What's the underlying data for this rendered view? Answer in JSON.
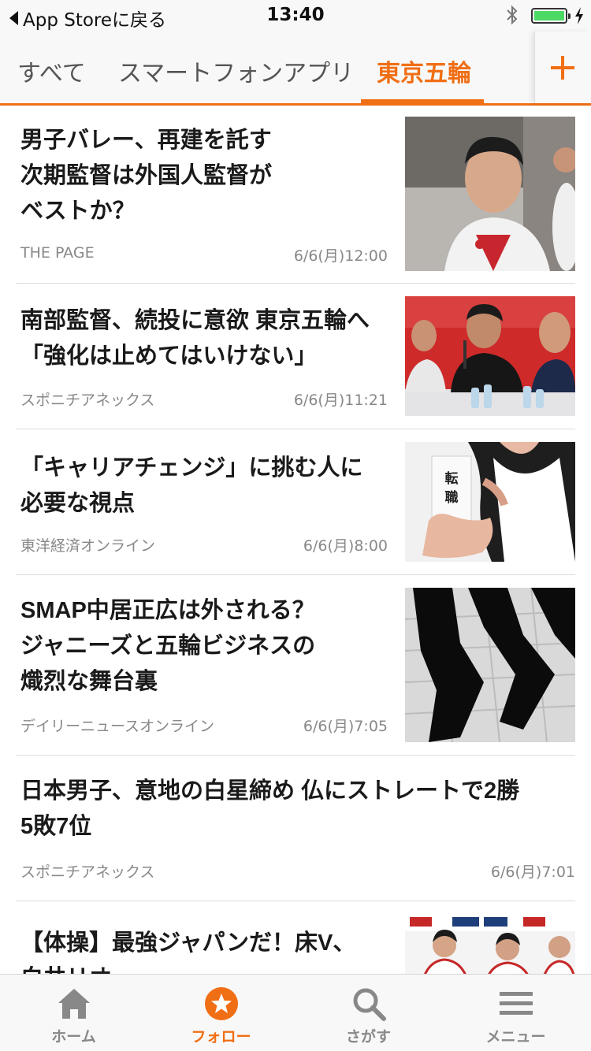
{
  "status_bar": {
    "back_label": "App Storeに戻る",
    "time": "13:40"
  },
  "tabs": [
    {
      "label": "すべて",
      "active": false
    },
    {
      "label": "スマートフォンアプリ",
      "active": false
    },
    {
      "label": "東京五輪",
      "active": true
    }
  ],
  "add_tab_icon": "plus-icon",
  "articles": [
    {
      "title_lines": [
        "男子バレー、再建を託す",
        "次期監督は外国人監督が",
        "ベストか？"
      ],
      "source": "THE PAGE",
      "time": "6/6(月)12:00",
      "thumb": "volleyball-player-photo"
    },
    {
      "title_lines": [
        "南部監督、続投に意欲 東京五輪へ",
        "「強化は止めてはいけない」"
      ],
      "source": "スポニチアネックス",
      "time": "6/6(月)11:21",
      "thumb": "press-conference-photo"
    },
    {
      "title_lines": [
        "「キャリアチェンジ」に挑む人に",
        "必要な視点"
      ],
      "source": "東洋経済オンライン",
      "time": "6/6(月)8:00",
      "thumb": "career-change-card-photo",
      "card_text": "転職"
    },
    {
      "title_lines": [
        "SMAP中居正広は外される？",
        "ジャニーズと五輪ビジネスの",
        "熾烈な舞台裏"
      ],
      "source": "デイリーニュースオンライン",
      "time": "6/6(月)7:05",
      "thumb": "shadows-photo"
    },
    {
      "title_lines": [
        "日本男子、意地の白星締め 仏にストレートで2勝",
        "5敗7位"
      ],
      "source": "スポニチアネックス",
      "time": "6/6(月)7:01",
      "thumb": ""
    },
    {
      "title_lines": [
        "【体操】最強ジャパンだ！床V、",
        "白井リオ"
      ],
      "source": "",
      "time": "",
      "thumb": "gymnastics-team-photo"
    }
  ],
  "bottom_nav": [
    {
      "label": "ホーム",
      "icon": "home-icon",
      "active": false
    },
    {
      "label": "フォロー",
      "icon": "star-circle-icon",
      "active": true
    },
    {
      "label": "さがす",
      "icon": "search-icon",
      "active": false
    },
    {
      "label": "メニュー",
      "icon": "menu-icon",
      "active": false
    }
  ],
  "colors": {
    "accent": "#f06e14",
    "text": "#1a1a1a",
    "muted": "#888888",
    "bar": "#f8f8f8"
  }
}
